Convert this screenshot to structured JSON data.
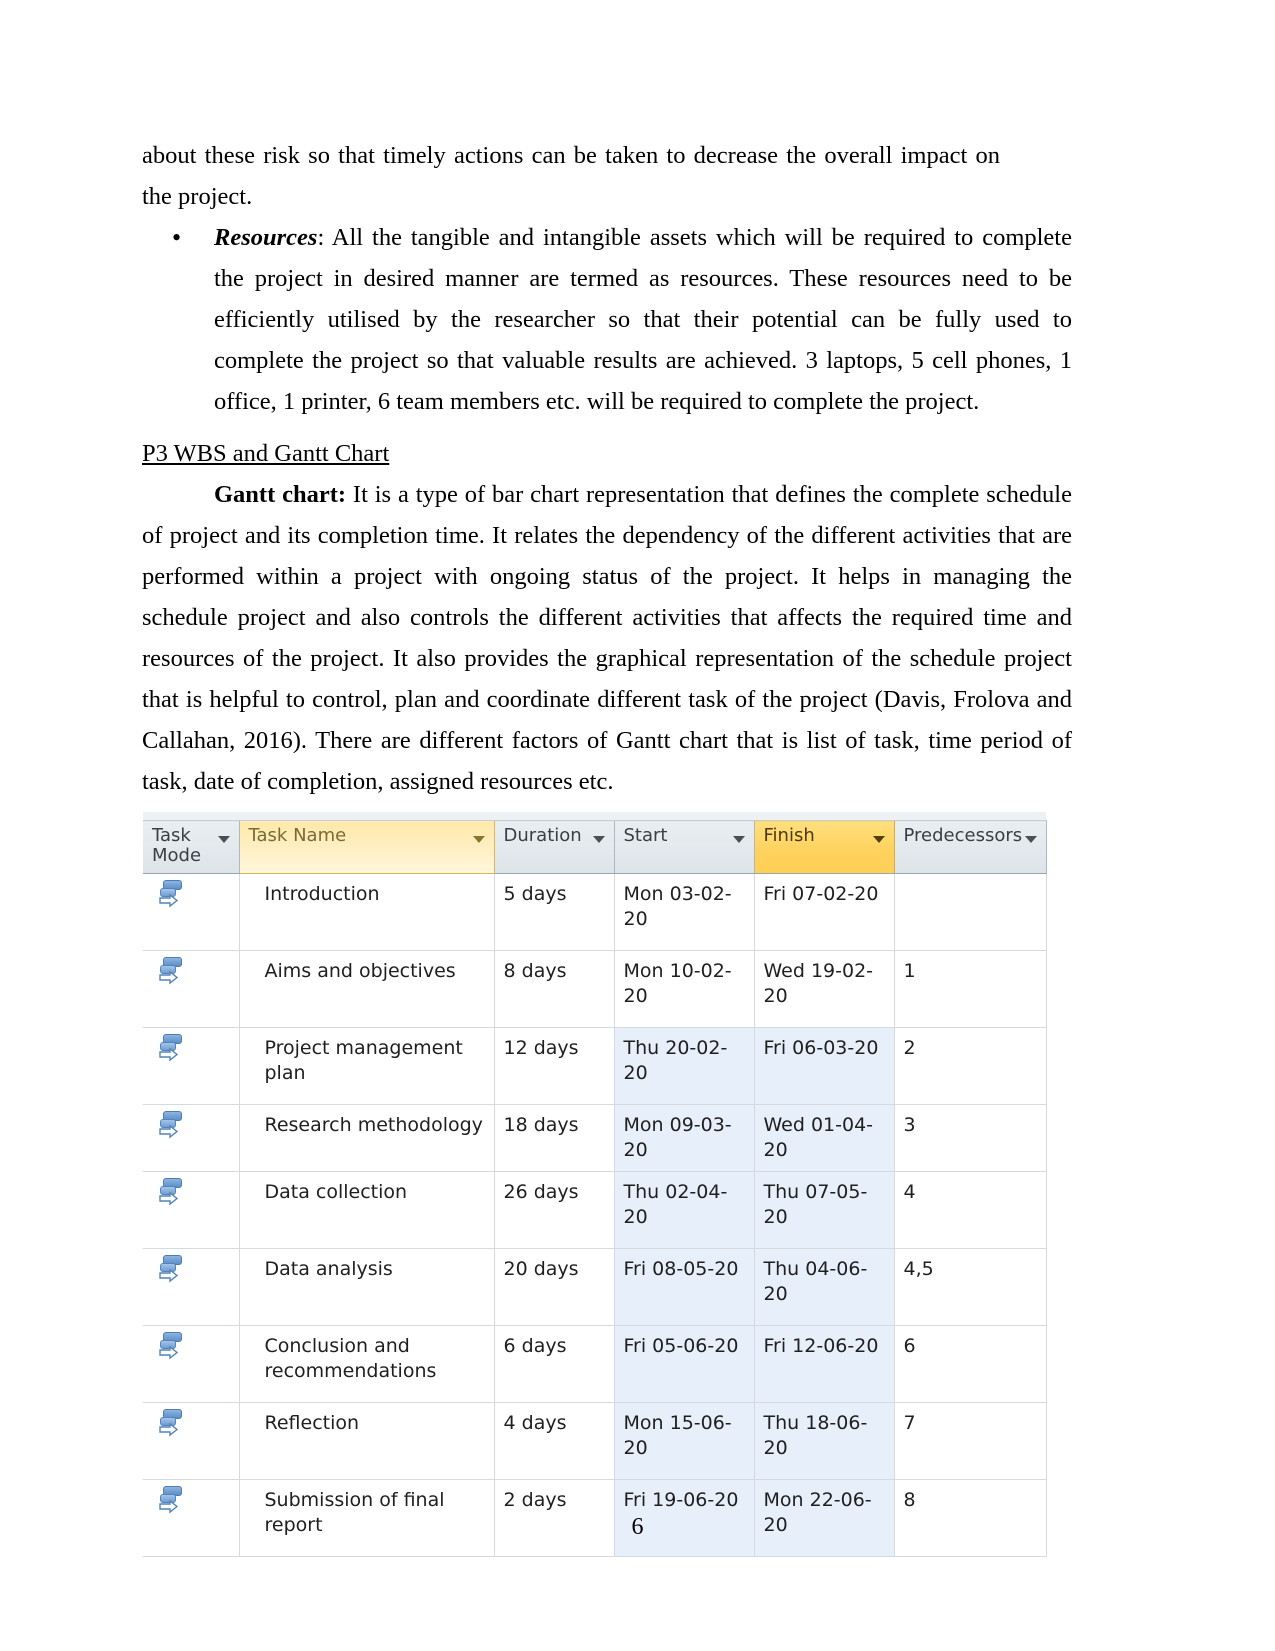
{
  "document": {
    "page_number": "6",
    "paragraph_continued": "about these risk so that timely actions can be taken to decrease the overall impact on the project.",
    "bullet": {
      "marker": "•",
      "lead_term": "Resources",
      "text": ": All the tangible and intangible assets which will be required to complete the project in desired manner are termed as resources. These resources need to be efficiently utilised by the researcher so that their potential can be fully used to complete the project so that valuable results are achieved. 3 laptops, 5 cell phones, 1 office, 1 printer, 6 team members etc. will be required to complete the project."
    },
    "section_heading": "P3 WBS and Gantt Chart",
    "gantt_paragraph": {
      "lead_term": "Gantt chart:",
      "text": " It is a type of bar chart representation that defines the complete schedule of project and its completion time. It relates the dependency of the different activities that are performed within a project with ongoing status of the project. It helps in managing the schedule project and also controls the different activities that affects the required time and resources of the project. It also provides the graphical representation of the schedule project that is helpful to control, plan and coordinate different task of the project (Davis, Frolova and Callahan, 2016). There are different factors of Gantt chart that is list of task, time period of task, date of completion, assigned resources etc."
    }
  },
  "colors": {
    "header_highlight": "#ffd25e",
    "header_name_highlight": "#ffeec0",
    "header_normal": "#dde4e9",
    "row_tint": "#e6effa",
    "task_mode_icon": "#5b8fc9"
  },
  "project_table": {
    "columns": [
      {
        "key": "task_mode",
        "label": "Task Mode",
        "highlight": false,
        "has_filter": true
      },
      {
        "key": "task_name",
        "label": "Task Name",
        "highlight": "name",
        "has_filter": true
      },
      {
        "key": "duration",
        "label": "Duration",
        "highlight": false,
        "has_filter": true
      },
      {
        "key": "start",
        "label": "Start",
        "highlight": false,
        "has_filter": true
      },
      {
        "key": "finish",
        "label": "Finish",
        "highlight": true,
        "has_filter": true
      },
      {
        "key": "predecessors",
        "label": "Predecessors",
        "highlight": false,
        "has_filter": true
      }
    ],
    "rows": [
      {
        "task_mode_icon": "auto-schedule-icon",
        "task_name": "Introduction",
        "duration": "5 days",
        "start": "Mon 03-02-20",
        "finish": "Fri 07-02-20",
        "predecessors": "",
        "tall": true,
        "tint": false
      },
      {
        "task_mode_icon": "auto-schedule-icon",
        "task_name": "Aims and objectives",
        "duration": "8 days",
        "start": "Mon 10-02-20",
        "finish": "Wed 19-02-20",
        "predecessors": "1",
        "tall": true,
        "tint": false
      },
      {
        "task_mode_icon": "auto-schedule-icon",
        "task_name": "Project management plan",
        "duration": "12 days",
        "start": "Thu 20-02-20",
        "finish": "Fri 06-03-20",
        "predecessors": "2",
        "tall": true,
        "tint": true
      },
      {
        "task_mode_icon": "auto-schedule-icon",
        "task_name": "Research methodology",
        "duration": "18 days",
        "start": "Mon 09-03-20",
        "finish": "Wed 01-04-20",
        "predecessors": "3",
        "tall": false,
        "tint": true
      },
      {
        "task_mode_icon": "auto-schedule-icon",
        "task_name": "Data collection",
        "duration": "26 days",
        "start": "Thu 02-04-20",
        "finish": "Thu 07-05-20",
        "predecessors": "4",
        "tall": true,
        "tint": true
      },
      {
        "task_mode_icon": "auto-schedule-icon",
        "task_name": "Data analysis",
        "duration": "20 days",
        "start": "Fri 08-05-20",
        "finish": "Thu 04-06-20",
        "predecessors": "4,5",
        "tall": true,
        "tint": true
      },
      {
        "task_mode_icon": "auto-schedule-icon",
        "task_name": "Conclusion and recommendations",
        "duration": "6 days",
        "start": "Fri 05-06-20",
        "finish": "Fri 12-06-20",
        "predecessors": "6",
        "tall": true,
        "tint": true
      },
      {
        "task_mode_icon": "auto-schedule-icon",
        "task_name": "Reflection",
        "duration": "4 days",
        "start": "Mon 15-06-20",
        "finish": "Thu 18-06-20",
        "predecessors": "7",
        "tall": true,
        "tint": true
      },
      {
        "task_mode_icon": "auto-schedule-icon",
        "task_name": "Submission of final report",
        "duration": "2 days",
        "start": "Fri 19-06-20",
        "finish": "Mon 22-06-20",
        "predecessors": "8",
        "tall": true,
        "tint": true
      }
    ]
  }
}
